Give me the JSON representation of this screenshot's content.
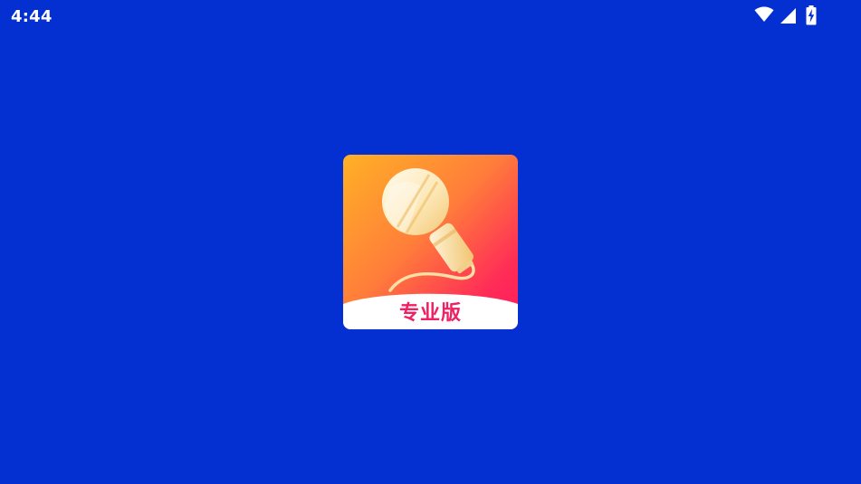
{
  "status_bar": {
    "time": "4:44",
    "icons": [
      "wifi-icon",
      "signal-icon",
      "battery-charging-icon"
    ]
  },
  "app": {
    "icon_name": "microphone-icon",
    "badge_label": "专业版"
  },
  "colors": {
    "background": "#0430d2",
    "icon_gradient_start": "#ffb126",
    "icon_gradient_end": "#ff1b5d",
    "badge_text": "#f21f63"
  }
}
